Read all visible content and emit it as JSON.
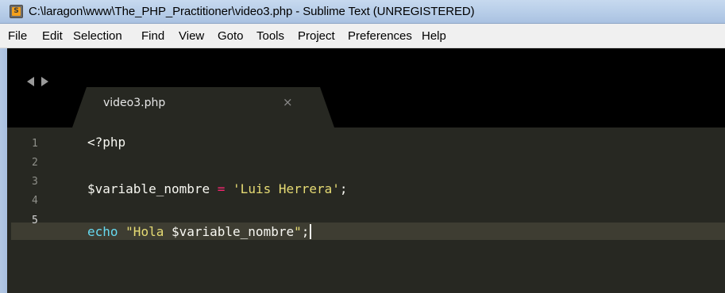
{
  "window": {
    "title": "C:\\laragon\\www\\The_PHP_Practitioner\\video3.php - Sublime Text (UNREGISTERED)",
    "icon": "sublime-text-icon"
  },
  "menu": {
    "items": [
      "File",
      "Edit",
      "Selection",
      "Find",
      "View",
      "Goto",
      "Tools",
      "Project",
      "Preferences",
      "Help"
    ]
  },
  "tabs": [
    {
      "label": "video3.php",
      "close_glyph": "×",
      "active": true
    }
  ],
  "editor": {
    "active_line": 5,
    "lines": [
      {
        "number": "1",
        "tokens": [
          {
            "text": "<?php",
            "kind": "plain"
          }
        ]
      },
      {
        "number": "2",
        "tokens": []
      },
      {
        "number": "3",
        "tokens": [
          {
            "text": "$variable_nombre ",
            "kind": "plain"
          },
          {
            "text": "=",
            "kind": "op"
          },
          {
            "text": " ",
            "kind": "plain"
          },
          {
            "text": "'Luis Herrera'",
            "kind": "str"
          },
          {
            "text": ";",
            "kind": "plain"
          }
        ]
      },
      {
        "number": "4",
        "tokens": []
      },
      {
        "number": "5",
        "tokens": [
          {
            "text": "echo",
            "kind": "kw"
          },
          {
            "text": " ",
            "kind": "plain"
          },
          {
            "text": "\"Hola ",
            "kind": "str"
          },
          {
            "text": "$variable_nombre",
            "kind": "plain"
          },
          {
            "text": "\"",
            "kind": "str"
          },
          {
            "text": ";",
            "kind": "plain"
          }
        ]
      }
    ]
  },
  "colors": {
    "background": "#272822",
    "keyword": "#66d9ef",
    "string": "#e6db74",
    "operator": "#f92672",
    "text": "#f8f8f2"
  }
}
